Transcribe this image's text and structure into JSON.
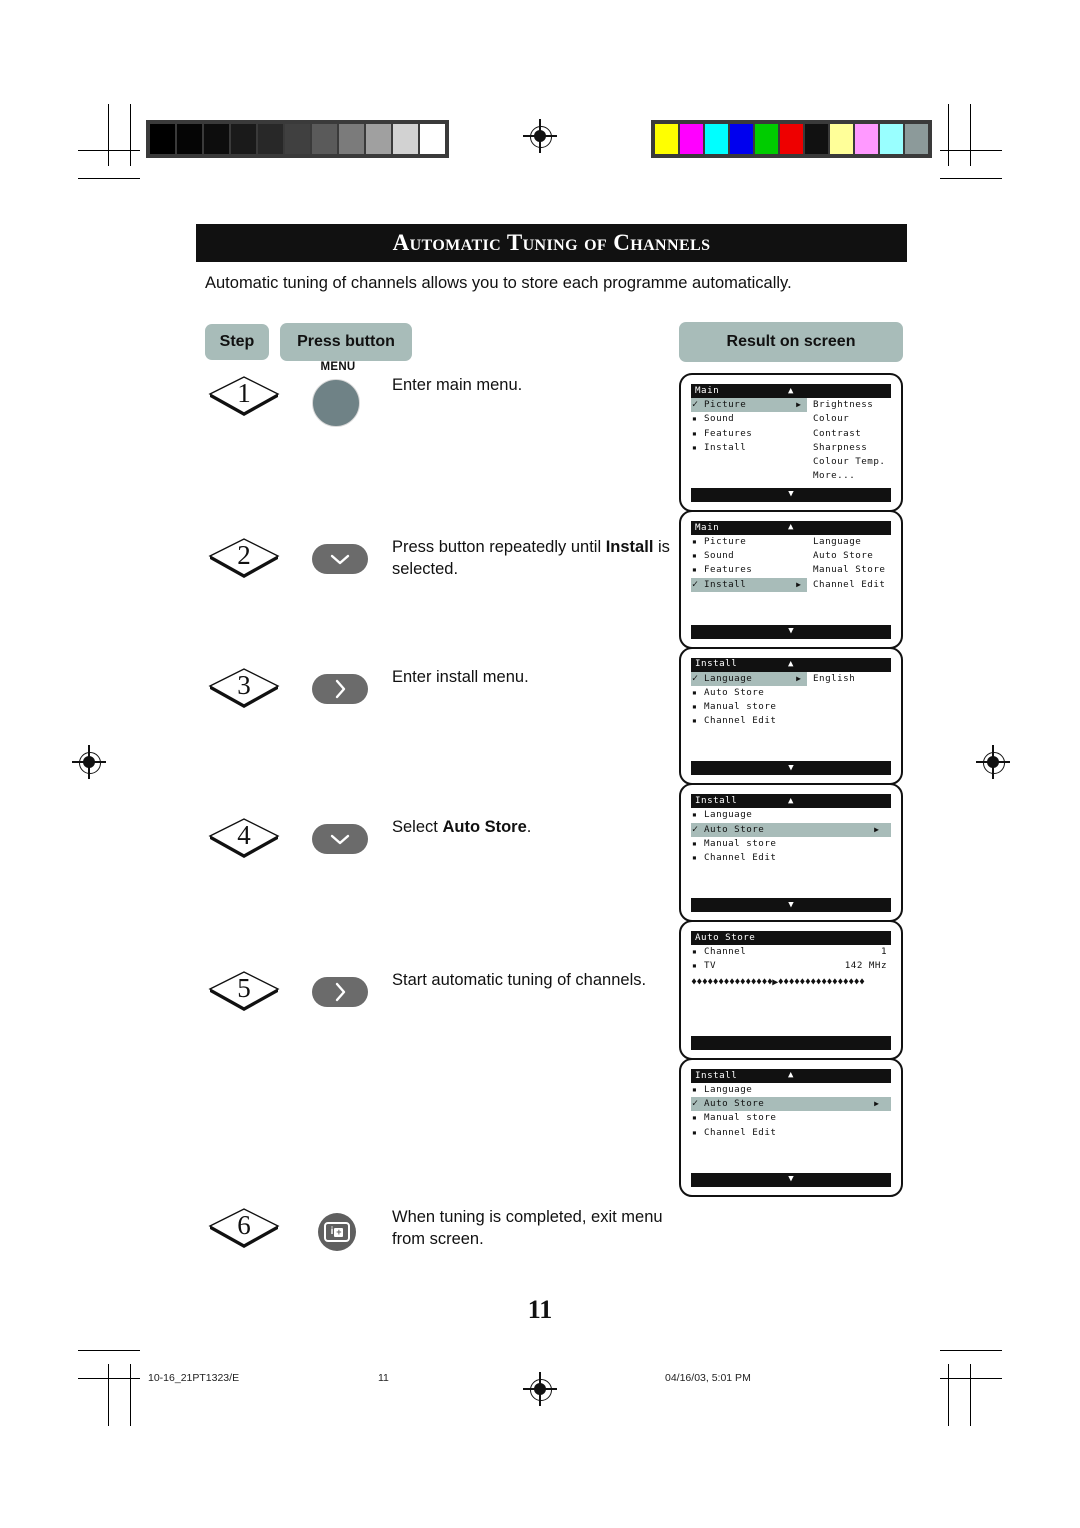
{
  "document": {
    "title": "Automatic Tuning of Channels",
    "intro": "Automatic tuning of channels allows you to store each programme automatically.",
    "page_number": "11"
  },
  "columns": {
    "step": "Step",
    "press_button": "Press button",
    "result_on_screen": "Result on screen"
  },
  "steps": [
    {
      "number": "1",
      "button_label": "MENU",
      "button_icon": "menu-round-button",
      "text_plain": "Enter main menu.",
      "text_parts": [
        {
          "t": "Enter main menu.",
          "bold": false
        }
      ]
    },
    {
      "number": "2",
      "button_label": "",
      "button_icon": "chevron-down-icon",
      "text_plain": "Press button repeatedly until Install is selected.",
      "text_parts": [
        {
          "t": "Press button repeatedly until ",
          "bold": false
        },
        {
          "t": "Install",
          "bold": true
        },
        {
          "t": " is selected.",
          "bold": false
        }
      ]
    },
    {
      "number": "3",
      "button_label": "",
      "button_icon": "chevron-right-icon",
      "text_plain": "Enter install menu.",
      "text_parts": [
        {
          "t": "Enter install menu.",
          "bold": false
        }
      ]
    },
    {
      "number": "4",
      "button_label": "",
      "button_icon": "chevron-down-icon",
      "text_plain": "Select Auto Store.",
      "text_parts": [
        {
          "t": "Select ",
          "bold": false
        },
        {
          "t": "Auto Store",
          "bold": true
        },
        {
          "t": ".",
          "bold": false
        }
      ]
    },
    {
      "number": "5",
      "button_label": "",
      "button_icon": "chevron-right-icon",
      "text_plain": "Start automatic tuning of channels.",
      "text_parts": [
        {
          "t": "Start automatic tuning of channels.",
          "bold": false
        }
      ]
    },
    {
      "number": "6",
      "button_label": "",
      "button_icon": "info-screen-icon",
      "text_plain": "When tuning is completed, exit menu from screen.",
      "text_parts": [
        {
          "t": "When tuning is completed, exit menu from screen.",
          "bold": false
        }
      ]
    }
  ],
  "osd_screens": [
    {
      "header": "Main",
      "up_arrow": "▲",
      "down_arrow": "▼",
      "show_footer": true,
      "rows": [
        {
          "marker": "check",
          "label": "Picture",
          "arrow": "▶",
          "selected": "left",
          "right": "Brightness"
        },
        {
          "marker": "bullet",
          "label": "Sound",
          "arrow": "",
          "selected": "none",
          "right": "Colour"
        },
        {
          "marker": "bullet",
          "label": "Features",
          "arrow": "",
          "selected": "none",
          "right": "Contrast"
        },
        {
          "marker": "bullet",
          "label": "Install",
          "arrow": "",
          "selected": "none",
          "right": "Sharpness"
        },
        {
          "marker": "none",
          "label": "",
          "arrow": "",
          "selected": "none",
          "right": "Colour Temp."
        },
        {
          "marker": "none",
          "label": "",
          "arrow": "",
          "selected": "none",
          "right": "More..."
        }
      ]
    },
    {
      "header": "Main",
      "up_arrow": "▲",
      "down_arrow": "▼",
      "show_footer": true,
      "rows": [
        {
          "marker": "bullet",
          "label": "Picture",
          "arrow": "",
          "selected": "none",
          "right": "Language"
        },
        {
          "marker": "bullet",
          "label": "Sound",
          "arrow": "",
          "selected": "none",
          "right": "Auto Store"
        },
        {
          "marker": "bullet",
          "label": "Features",
          "arrow": "",
          "selected": "none",
          "right": "Manual Store"
        },
        {
          "marker": "check",
          "label": "Install",
          "arrow": "▶",
          "selected": "left",
          "right": "Channel Edit"
        },
        {
          "marker": "none",
          "label": "",
          "arrow": "",
          "selected": "none",
          "right": ""
        },
        {
          "marker": "none",
          "label": "",
          "arrow": "",
          "selected": "none",
          "right": ""
        }
      ]
    },
    {
      "header": "Install",
      "up_arrow": "▲",
      "down_arrow": "▼",
      "show_footer": true,
      "rows": [
        {
          "marker": "check",
          "label": "Language",
          "arrow": "▶",
          "selected": "left",
          "right": "English"
        },
        {
          "marker": "bullet",
          "label": "Auto Store",
          "arrow": "",
          "selected": "none",
          "right": ""
        },
        {
          "marker": "bullet",
          "label": "Manual store",
          "arrow": "",
          "selected": "none",
          "right": ""
        },
        {
          "marker": "bullet",
          "label": "Channel Edit",
          "arrow": "",
          "selected": "none",
          "right": ""
        },
        {
          "marker": "none",
          "label": "",
          "arrow": "",
          "selected": "none",
          "right": ""
        },
        {
          "marker": "none",
          "label": "",
          "arrow": "",
          "selected": "none",
          "right": ""
        }
      ]
    },
    {
      "header": "Install",
      "up_arrow": "▲",
      "down_arrow": "▼",
      "show_footer": true,
      "rows": [
        {
          "marker": "bullet",
          "label": "Language",
          "arrow": "",
          "selected": "none",
          "right": ""
        },
        {
          "marker": "check",
          "label": "Auto Store",
          "arrow": "▶",
          "selected": "full",
          "right": ""
        },
        {
          "marker": "bullet",
          "label": "Manual store",
          "arrow": "",
          "selected": "none",
          "right": ""
        },
        {
          "marker": "bullet",
          "label": "Channel Edit",
          "arrow": "",
          "selected": "none",
          "right": ""
        },
        {
          "marker": "none",
          "label": "",
          "arrow": "",
          "selected": "none",
          "right": ""
        },
        {
          "marker": "none",
          "label": "",
          "arrow": "",
          "selected": "none",
          "right": ""
        }
      ]
    },
    {
      "header": "Auto Store",
      "up_arrow": "",
      "down_arrow": "",
      "show_footer": true,
      "kv_rows": [
        {
          "marker": "bullet",
          "label": "Channel",
          "value": "1"
        },
        {
          "marker": "bullet",
          "label": "TV",
          "value": "142 MHz"
        }
      ],
      "progress": "♦♦♦♦♦♦♦♦♦♦♦♦♦♦♦▶♦♦♦♦♦♦♦♦♦♦♦♦♦♦♦♦",
      "rows": []
    },
    {
      "header": "Install",
      "up_arrow": "▲",
      "down_arrow": "▼",
      "show_footer": true,
      "rows": [
        {
          "marker": "bullet",
          "label": "Language",
          "arrow": "",
          "selected": "none",
          "right": ""
        },
        {
          "marker": "check",
          "label": "Auto Store",
          "arrow": "▶",
          "selected": "full",
          "right": ""
        },
        {
          "marker": "bullet",
          "label": "Manual store",
          "arrow": "",
          "selected": "none",
          "right": ""
        },
        {
          "marker": "bullet",
          "label": "Channel Edit",
          "arrow": "",
          "selected": "none",
          "right": ""
        },
        {
          "marker": "none",
          "label": "",
          "arrow": "",
          "selected": "none",
          "right": ""
        },
        {
          "marker": "none",
          "label": "",
          "arrow": "",
          "selected": "none",
          "right": ""
        }
      ]
    }
  ],
  "footer": {
    "document_code": "10-16_21PT1323/E",
    "page": "11",
    "timestamp": "04/16/03, 5:01 PM"
  },
  "print_marks": {
    "grayscale_patches": [
      "#000000",
      "#050505",
      "#0d0d0d",
      "#1a1a1a",
      "#282828",
      "#404040",
      "#5a5a5a",
      "#7b7b7b",
      "#a0a0a0",
      "#d2d2d2",
      "#ffffff"
    ],
    "colour_patches": [
      "#ffff00",
      "#ff00ff",
      "#00ffff",
      "#0000ee",
      "#00cc00",
      "#ee0000",
      "#111111",
      "#ffff99",
      "#ff99ff",
      "#99ffff",
      "#8c9a9a"
    ]
  },
  "colors": {
    "accent_pill": "#a8bcb9",
    "button_dark": "#6b6b6b",
    "button_menu": "#6f8286",
    "osd_black": "#111111"
  }
}
